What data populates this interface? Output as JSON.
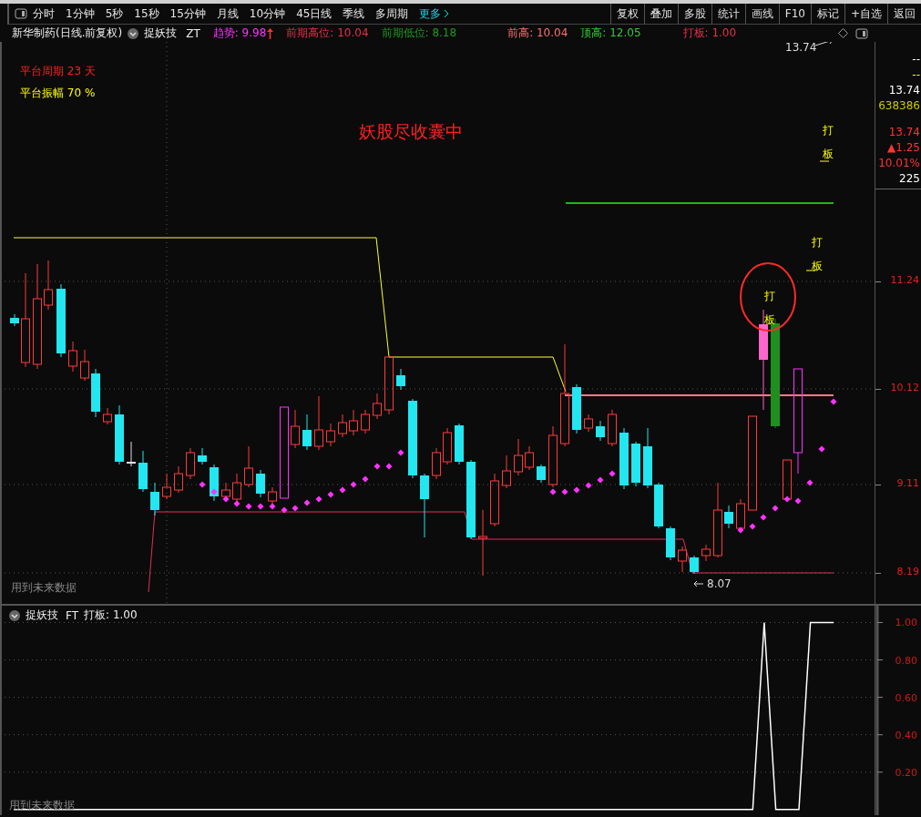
{
  "toolbar": {
    "periods": [
      {
        "label": "分时",
        "kind": "period",
        "selected": false
      },
      {
        "label": "1分钟",
        "kind": "period",
        "selected": false
      },
      {
        "label": "5秒",
        "kind": "period",
        "selected": false
      },
      {
        "label": "15秒",
        "kind": "period",
        "selected": false
      },
      {
        "label": "15分钟",
        "kind": "period",
        "selected": false
      },
      {
        "label": "月线",
        "kind": "period",
        "selected": false
      },
      {
        "label": "10分钟",
        "kind": "period",
        "selected": false
      },
      {
        "label": "45日线",
        "kind": "period",
        "selected": false
      },
      {
        "label": "季线",
        "kind": "period",
        "selected": false
      },
      {
        "label": "多周期",
        "kind": "period",
        "selected": false
      },
      {
        "label": "更多",
        "kind": "more",
        "selected": false
      }
    ],
    "actions": [
      "复权",
      "叠加",
      "多股",
      "统计",
      "画线",
      "F10",
      "标记",
      "+自选",
      "返回"
    ]
  },
  "header": {
    "stock": "新华制药(日线.前复权)",
    "indicator": "捉妖技",
    "mode": "ZT",
    "readings": [
      {
        "text": "趋势: 9.98",
        "color": "#ff33ff",
        "arrow": true
      },
      {
        "text": "前期高位: 10.04",
        "color": "#e8304a",
        "arrow": false
      },
      {
        "text": "前期低位: 8.18",
        "color": "#1f9a1f",
        "arrow": false
      },
      {
        "text": "前高: 10.04",
        "color": "#ff7070",
        "arrow": false
      },
      {
        "text": "顶高: 12.05",
        "color": "#33cc33",
        "arrow": false
      },
      {
        "text": "打板: 1.00",
        "color": "#e8304a",
        "arrow": false
      }
    ]
  },
  "chart": {
    "stats": [
      {
        "label": "平台周期",
        "value": "23 天",
        "color": "#ff2020"
      },
      {
        "label": "平台振幅",
        "value": "70 %",
        "color": "#ffff00"
      }
    ],
    "slogan": "妖股尽收囊中",
    "signals": [
      "打板",
      "打板",
      "打板"
    ],
    "high_label": "13.74",
    "low_label": "8.07",
    "note": "用到未来数据",
    "price_ticks": [
      "11.24",
      "10.12",
      "9.11",
      "8.19"
    ]
  },
  "quote": {
    "top": [
      {
        "text": "--",
        "color": "#ffffff"
      },
      {
        "text": "--",
        "color": "#ffff00"
      },
      {
        "text": "13.74",
        "color": "#ffffff"
      },
      {
        "text": "638386",
        "color": "#c8c800"
      }
    ],
    "bottom": [
      {
        "text": "13.74",
        "color": "#ff3333"
      },
      {
        "text": "▲1.25",
        "color": "#ff3333"
      },
      {
        "text": "10.01%",
        "color": "#ff3333"
      },
      {
        "text": "225",
        "color": "#ffffff"
      }
    ]
  },
  "subchart": {
    "indicator": "捉妖技",
    "mode": "FT",
    "reading": "打板: 1.00",
    "note": "用到未来数据",
    "chart_data": {
      "type": "line",
      "ylim": [
        -0.03,
        1.09
      ],
      "grid": true,
      "yticks": [
        {
          "value": 0.2,
          "label": "0.20"
        },
        {
          "value": 0.4,
          "label": "0.40"
        },
        {
          "value": 0.6,
          "label": "0.60"
        },
        {
          "value": 0.8,
          "label": "0.80"
        },
        {
          "value": 1,
          "label": "1.00"
        }
      ],
      "series": [
        {
          "color": "#ffffff",
          "values": [
            0,
            0,
            0,
            0,
            0,
            0,
            0,
            0,
            0,
            0,
            0,
            0,
            0,
            0,
            0,
            0,
            0,
            0,
            0,
            0,
            0,
            0,
            0,
            0,
            0,
            0,
            0,
            0,
            0,
            0,
            0,
            0,
            0,
            0,
            0,
            0,
            0,
            0,
            0,
            0,
            0,
            0,
            0,
            0,
            0,
            0,
            0,
            0,
            0,
            0,
            0,
            0,
            0,
            0,
            0,
            0,
            0,
            0,
            0,
            0,
            0,
            0,
            0,
            0,
            0,
            1,
            0,
            0,
            0,
            1,
            1,
            1
          ]
        }
      ]
    }
  }
}
